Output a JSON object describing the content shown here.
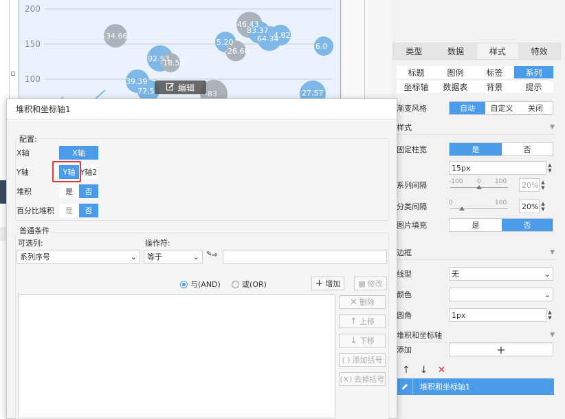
{
  "chart": {
    "y_ticks": [
      "200",
      "150",
      "100"
    ],
    "bubble_labels": [
      "-34.66",
      "-46.43",
      "83.37",
      "5.20",
      "-26.66",
      "64.34",
      "4.82",
      "6.0",
      "92.53",
      "-18.55",
      "39.39",
      "77.5",
      "-83",
      "27.57"
    ],
    "edit_label": "编辑"
  },
  "panel": {
    "main_tabs": [
      "类型",
      "数据",
      "样式",
      "特效"
    ],
    "sub_tabs": [
      "标题",
      "图例",
      "标签",
      "系列",
      "坐标轴",
      "数据表",
      "背景",
      "提示"
    ],
    "gradient": {
      "label": "渐变风格",
      "options": [
        "自动",
        "自定义",
        "关闭"
      ]
    },
    "style_section": "样式",
    "fixed_width": {
      "label": "固定柱宽",
      "options": [
        "是",
        "否"
      ],
      "value": "15px"
    },
    "series_gap": {
      "label": "系列间隔",
      "min": "-100",
      "mid": "0",
      "max": "100",
      "value": "20%",
      "level": 0.5
    },
    "category_gap": {
      "label": "分类间隔",
      "min": "0",
      "max": "100",
      "value": "20%",
      "level": 0.2
    },
    "image_fill": {
      "label": "图片填充",
      "options": [
        "是",
        "否"
      ]
    },
    "border_section": "边框",
    "line_type": {
      "label": "线型",
      "value": "无"
    },
    "color": {
      "label": "颜色"
    },
    "corner": {
      "label": "圆角",
      "value": "1px"
    },
    "axis_section": "堆积和坐标轴",
    "add_label": "添加",
    "axis_item": "堆积和坐标轴1"
  },
  "dialog": {
    "title": "堆积和坐标轴1",
    "config_label": "配置:",
    "x_axis": {
      "label": "X轴",
      "value": "X轴"
    },
    "y_axis": {
      "label": "Y轴",
      "options": [
        "Y轴",
        "Y轴2"
      ]
    },
    "stack": {
      "label": "堆积",
      "options": [
        "是",
        "否"
      ]
    },
    "percent_stack": {
      "label": "百分比堆积",
      "options": [
        "是",
        "否"
      ]
    },
    "condition_label": "普通条件",
    "column_label": "可选列:",
    "column_value": "系列序号",
    "operator_label": "操作符:",
    "operator_value": "等于",
    "and_label": "与(AND)",
    "or_label": "或(OR)",
    "buttons": {
      "add": "增加",
      "modify": "修改",
      "delete": "删除",
      "up": "上移",
      "down": "下移",
      "add_bracket": "添加括号",
      "remove_bracket": "去掉括号"
    }
  }
}
